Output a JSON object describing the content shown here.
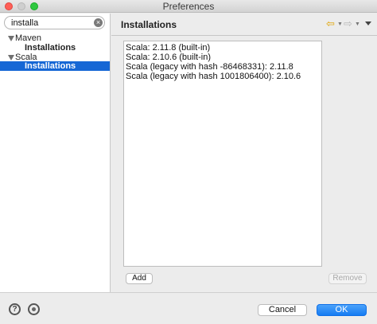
{
  "window": {
    "title": "Preferences"
  },
  "filter": {
    "value": "installa"
  },
  "tree": [
    {
      "label": "Maven",
      "child": "Installations"
    },
    {
      "label": "Scala",
      "child": "Installations"
    }
  ],
  "page": {
    "title": "Installations",
    "installations": [
      "Scala: 2.11.8 (built-in)",
      "Scala: 2.10.6 (built-in)",
      "Scala (legacy with hash -86468331): 2.11.8",
      "Scala (legacy with hash 1001806400): 2.10.6"
    ],
    "add_label": "Add",
    "remove_label": "Remove"
  },
  "footer": {
    "cancel_label": "Cancel",
    "ok_label": "OK"
  },
  "colors": {
    "selection": "#1667d5",
    "ok_button": "#1a7ef3",
    "back_arrow": "#e0a300"
  }
}
